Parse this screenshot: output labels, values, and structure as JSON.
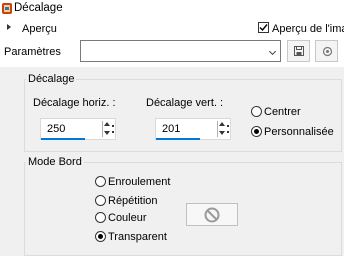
{
  "window": {
    "title": "Décalage"
  },
  "preview": {
    "section_label": "Aperçu",
    "checkbox_label": "Aperçu de l'image",
    "checked": true
  },
  "presets": {
    "label": "Paramètres",
    "value": ""
  },
  "offset": {
    "group_title": "Décalage",
    "horiz_label": "Décalage horiz. :",
    "horiz_value": "250",
    "vert_label": "Décalage vert. :",
    "vert_value": "201",
    "options": [
      {
        "label": "Centrer",
        "selected": false
      },
      {
        "label": "Personnalisée",
        "selected": true
      }
    ]
  },
  "border_mode": {
    "group_title": "Mode Bord",
    "options": [
      {
        "label": "Enroulement",
        "selected": false
      },
      {
        "label": "Répétition",
        "selected": false
      },
      {
        "label": "Couleur",
        "selected": false
      },
      {
        "label": "Transparent",
        "selected": true
      }
    ],
    "swatch_icon": "no-color-icon"
  },
  "colors": {
    "panel_background": "#f0f0f0",
    "focus_accent": "#0078d7",
    "app_icon": "#c8420c"
  }
}
